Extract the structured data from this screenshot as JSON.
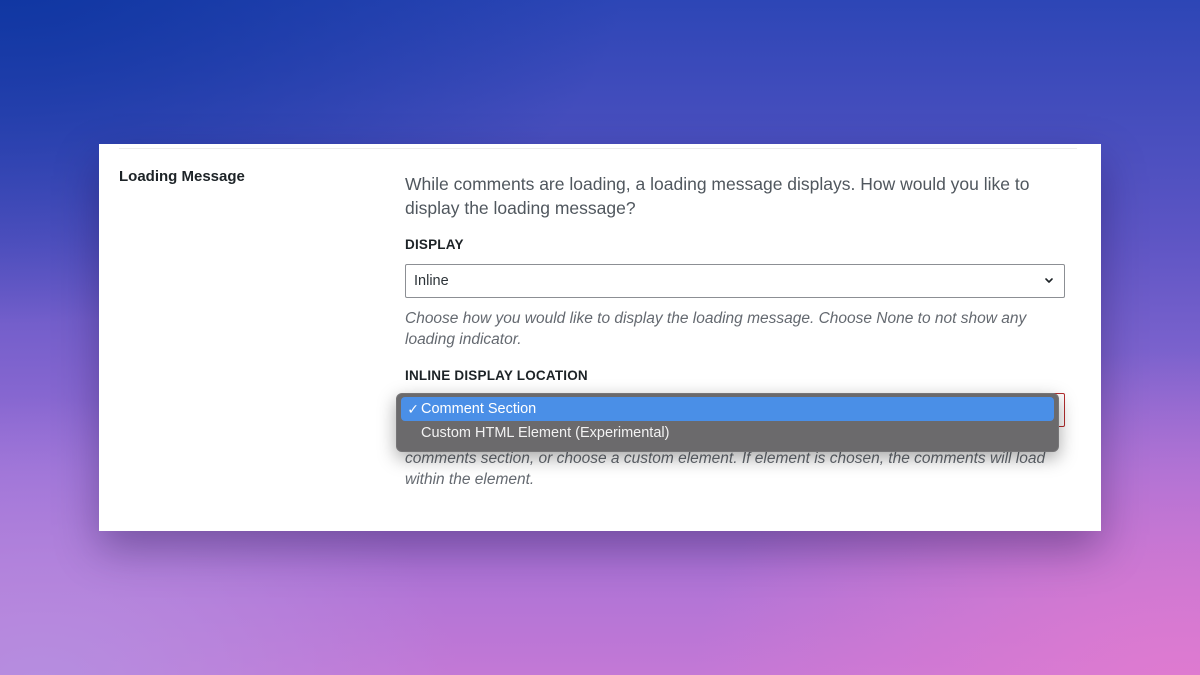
{
  "section": {
    "title": "Loading Message"
  },
  "intro_text": "While comments are loading, a loading message displays. How would you like to display the loading message?",
  "display_field": {
    "label": "DISPLAY",
    "selected": "Inline",
    "description": "Choose how you would like to display the loading message. Choose None to not show any loading indicator."
  },
  "location_field": {
    "label": "INLINE DISPLAY LOCATION",
    "description_visible": "comments section, or choose a custom element. If element is chosen, the comments will load within the element."
  },
  "dropdown": {
    "check_mark": "✓",
    "options": [
      {
        "label": "Comment Section",
        "selected": true
      },
      {
        "label": "Custom HTML Element (Experimental)",
        "selected": false
      }
    ]
  },
  "colors": {
    "selected_option": "#4a8fe7",
    "dropdown_bg": "#6b6a6c",
    "focus_border": "#b32d2e"
  },
  "icons": {
    "select_arrow": "chevron-down-icon",
    "check": "checkmark-icon"
  }
}
